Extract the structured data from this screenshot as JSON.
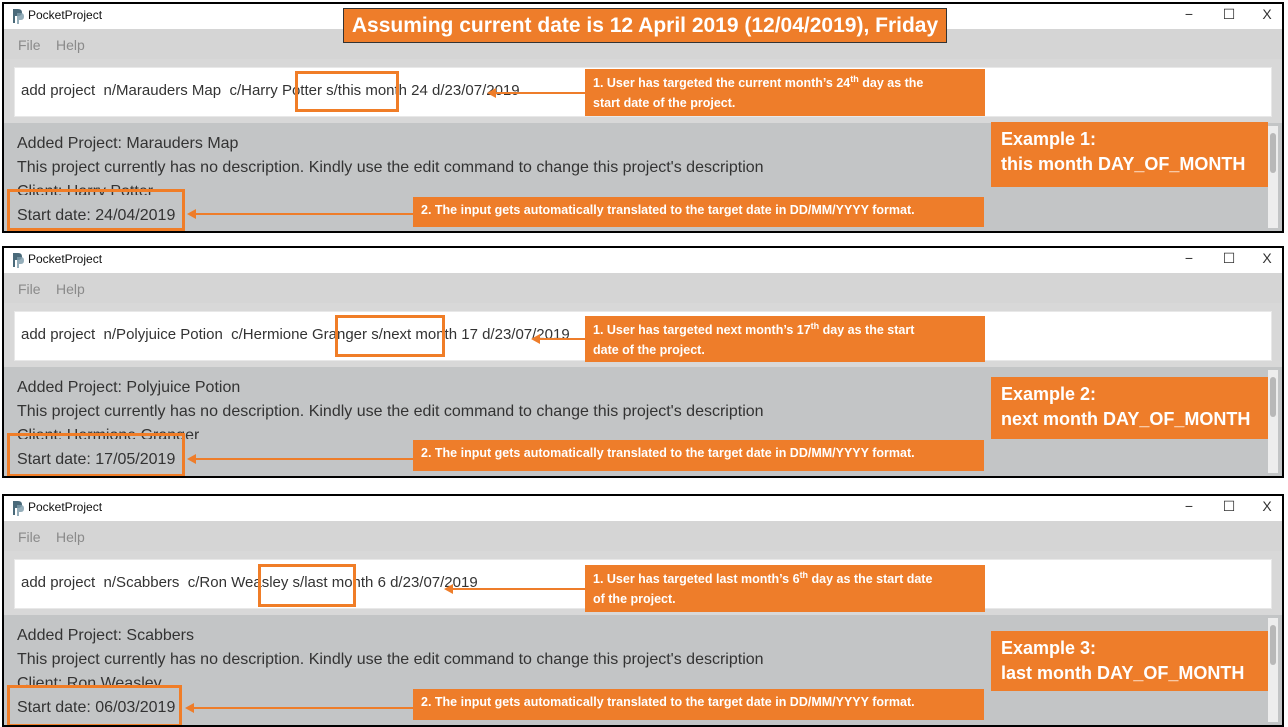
{
  "banner": "Assuming current date is 12 April 2019 (12/04/2019), Friday",
  "window": {
    "title": "PocketProject",
    "menu": [
      "File",
      "Help"
    ],
    "controls": [
      "−",
      "☐",
      "X"
    ]
  },
  "panels": [
    {
      "cmd_pre": "add project  n/Marauders Map  c/Harry Potter ",
      "cmd_hl": "s/this month 24",
      "cmd_post": " d/23/07/2019",
      "result_title": "Added Project: Marauders Map",
      "result_desc": "This project currently has no description. Kindly use the edit command to change this project's description",
      "result_client": "Client: Harry Potter",
      "result_start": "Start date: 24/04/2019",
      "callout1_line1": "1. User has targeted the current month’s 24",
      "callout1_sup": "th",
      "callout1_line1b": " day as the",
      "callout1_line2": "start date of the project.",
      "callout2": "2. The input gets automatically translated to the target date in DD/MM/YYYY format.",
      "example_title": "Example 1:",
      "example_sub": "this month DAY_OF_MONTH"
    },
    {
      "cmd_pre": "add project  n/Polyjuice Potion  c/Hermione Granger ",
      "cmd_hl": "s/next month 17",
      "cmd_post": " d/23/07/2019",
      "result_title": "Added Project: Polyjuice Potion",
      "result_desc": "This project currently has no description. Kindly use the edit command to change this project's description",
      "result_client": "Client: Hermione Granger",
      "result_start": "Start date: 17/05/2019",
      "callout1_line1": "1. User has targeted next month’s 17",
      "callout1_sup": "th",
      "callout1_line1b": " day as the start",
      "callout1_line2": "date of the project.",
      "callout2": "2. The input gets automatically translated to the target date in DD/MM/YYYY format.",
      "example_title": "Example 2:",
      "example_sub": "next month DAY_OF_MONTH"
    },
    {
      "cmd_pre": "add project  n/Scabbers  c/Ron Weasley ",
      "cmd_hl": "s/last month 6",
      "cmd_post": " d/23/07/2019",
      "result_title": "Added Project: Scabbers",
      "result_desc": "This project currently has no description. Kindly use the edit command to change this project's description",
      "result_client": "Client: Ron Weasley",
      "result_start": "Start date: 06/03/2019",
      "callout1_line1": "1. User has targeted last month’s 6",
      "callout1_sup": "th",
      "callout1_line1b": " day as the start date",
      "callout1_line2": "of the project.",
      "callout2": "2. The input gets automatically translated to the target date in DD/MM/YYYY format.",
      "example_title": "Example 3:",
      "example_sub": "last month DAY_OF_MONTH"
    }
  ],
  "colors": {
    "accent": "#ee7d2a",
    "result_bg": "#c3c5c6"
  }
}
